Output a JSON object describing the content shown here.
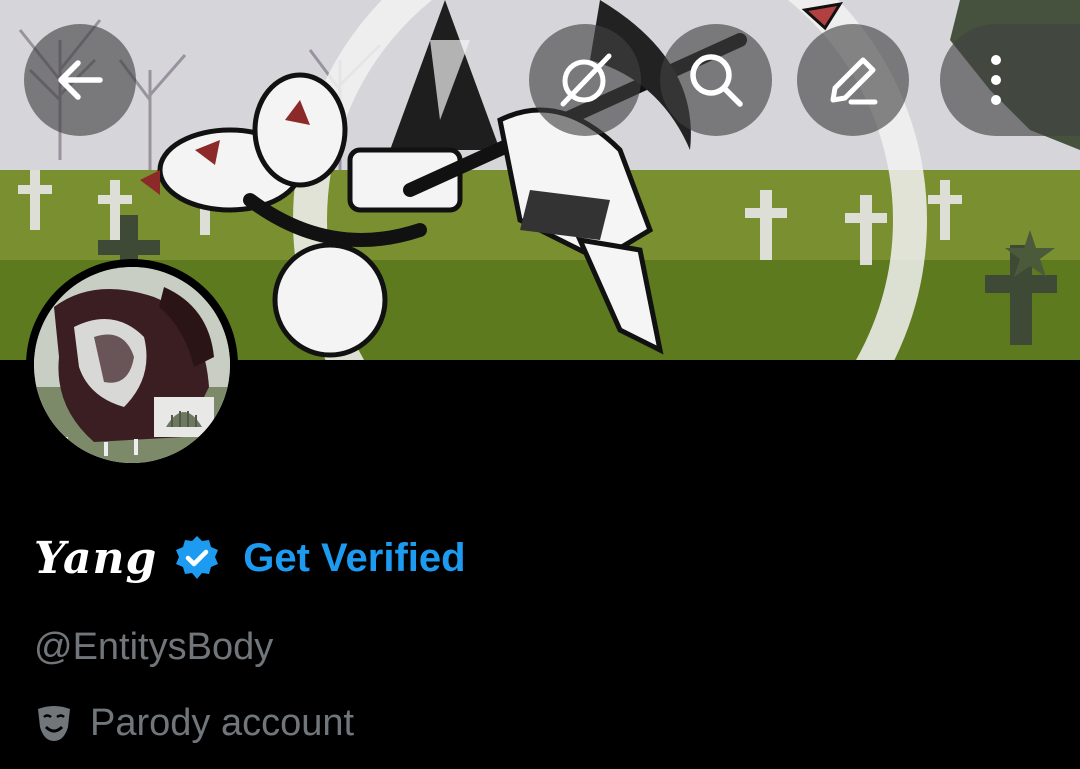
{
  "header": {
    "back_icon": "arrow-left-icon",
    "grok_icon": "grok-icon",
    "search_icon": "search-icon",
    "edit_icon": "pencil-icon",
    "more_icon": "more-vertical-icon"
  },
  "profile": {
    "display_name": "Yang",
    "verified_badge_icon": "verified-badge-icon",
    "get_verified_label": "Get Verified",
    "handle": "@EntitysBody",
    "parody_icon": "theater-mask-icon",
    "parody_label": "Parody account"
  },
  "colors": {
    "background": "#000000",
    "accent": "#1d9bf0",
    "secondary_text": "#71767b",
    "overlay_button": "#404040"
  }
}
